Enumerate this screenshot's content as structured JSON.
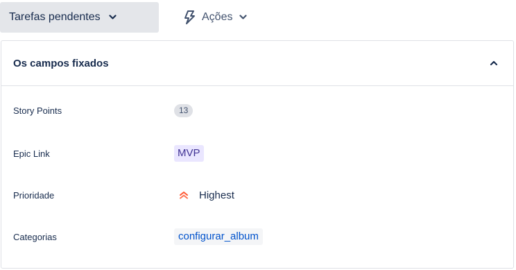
{
  "toolbar": {
    "status_label": "Tarefas pendentes",
    "actions_label": "Ações"
  },
  "panel": {
    "title": "Os campos fixados",
    "fields": {
      "story_points": {
        "label": "Story Points",
        "value": "13"
      },
      "epic_link": {
        "label": "Epic Link",
        "value": "MVP"
      },
      "priority": {
        "label": "Prioridade",
        "value": "Highest"
      },
      "categories": {
        "label": "Categorias",
        "value": "configurar_album"
      }
    }
  },
  "icons": {
    "status_chevron": "chevron-down-icon",
    "actions_bolt": "lightning-bolt-icon",
    "actions_chevron": "chevron-down-icon",
    "collapse": "chevron-up-icon",
    "priority": "priority-highest-icon"
  },
  "colors": {
    "priority_highest": "#ff5630",
    "epic_background": "#eae6ff",
    "epic_text": "#403294",
    "link_text": "#0052cc"
  }
}
